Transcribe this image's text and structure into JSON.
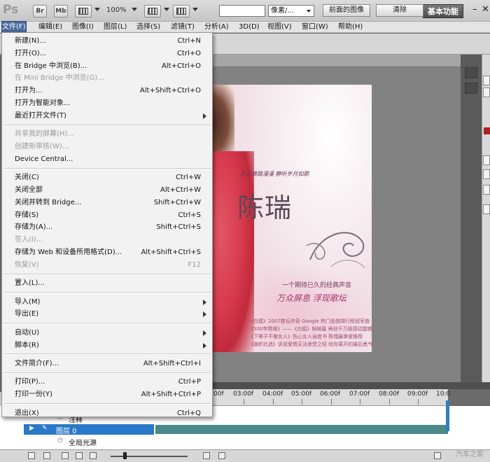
{
  "app": {
    "logo": "Ps",
    "toolbar_buttons": [
      "Br",
      "Mb"
    ],
    "zoom": "100%",
    "workspace": "基本功能",
    "window_controls": [
      "–",
      "✕"
    ]
  },
  "menubar": [
    "文件(F)",
    "编辑(E)",
    "图像(I)",
    "图层(L)",
    "选择(S)",
    "滤镜(T)",
    "分析(A)",
    "3D(D)",
    "视图(V)",
    "窗口(W)",
    "帮助(H)"
  ],
  "options_bar": {
    "unit_select": "像素/...",
    "front_image_button": "前面的图像",
    "clear_button": "清除"
  },
  "file_menu": {
    "groups": [
      [
        {
          "label": "新建(N)...",
          "shortcut": "Ctrl+N"
        },
        {
          "label": "打开(O)...",
          "shortcut": "Ctrl+O"
        },
        {
          "label": "在 Bridge 中浏览(B)...",
          "shortcut": "Alt+Ctrl+O"
        },
        {
          "label": "在 Mini Bridge 中浏览(G)...",
          "shortcut": "",
          "disabled": true
        },
        {
          "label": "打开为...",
          "shortcut": "Alt+Shift+Ctrl+O"
        },
        {
          "label": "打开为智能对象...",
          "shortcut": ""
        },
        {
          "label": "最近打开文件(T)",
          "shortcut": "",
          "submenu": true
        }
      ],
      [
        {
          "label": "共享我的屏幕(H)...",
          "shortcut": "",
          "disabled": true
        },
        {
          "label": "创建新审核(W)...",
          "shortcut": "",
          "disabled": true
        },
        {
          "label": "Device Central...",
          "shortcut": ""
        }
      ],
      [
        {
          "label": "关闭(C)",
          "shortcut": "Ctrl+W"
        },
        {
          "label": "关闭全部",
          "shortcut": "Alt+Ctrl+W"
        },
        {
          "label": "关闭并转到 Bridge...",
          "shortcut": "Shift+Ctrl+W"
        },
        {
          "label": "存储(S)",
          "shortcut": "Ctrl+S"
        },
        {
          "label": "存储为(A)...",
          "shortcut": "Shift+Ctrl+S"
        },
        {
          "label": "签入(I)...",
          "shortcut": "",
          "disabled": true
        },
        {
          "label": "存储为 Web 和设备所用格式(D)...",
          "shortcut": "Alt+Shift+Ctrl+S"
        },
        {
          "label": "恢复(V)",
          "shortcut": "F12",
          "disabled": true
        }
      ],
      [
        {
          "label": "置入(L)...",
          "shortcut": ""
        }
      ],
      [
        {
          "label": "导入(M)",
          "shortcut": "",
          "submenu": true
        },
        {
          "label": "导出(E)",
          "shortcut": "",
          "submenu": true
        }
      ],
      [
        {
          "label": "自动(U)",
          "shortcut": "",
          "submenu": true
        },
        {
          "label": "脚本(R)",
          "shortcut": "",
          "submenu": true
        }
      ],
      [
        {
          "label": "文件简介(F)...",
          "shortcut": "Alt+Shift+Ctrl+I"
        }
      ],
      [
        {
          "label": "打印(P)...",
          "shortcut": "Ctrl+P"
        },
        {
          "label": "打印一份(Y)",
          "shortcut": "Alt+Shift+Ctrl+P"
        }
      ],
      [
        {
          "label": "退出(X)",
          "shortcut": "Ctrl+Q"
        }
      ]
    ]
  },
  "poster": {
    "subtitle": "走过情路漫漫  静听岁月如歌",
    "name": "陈瑞",
    "tagline": "一个期待已久的经典声音",
    "motto": "万众屏息  浮现歌坛",
    "info_lines": [
      "《白狐》2007数坛传奇  Google 热门金曲排行榜冠军曲",
      "《300年情缘》——《白狐》姊妹篇  再创千万级感动震撼",
      "《下辈子不做女人》伤心女人自度书  陈瑞最挚爱推荐",
      "《旗帜社选》诉说爱情无法承受之轻  给你离开的最后勇气"
    ]
  },
  "timeline": {
    "ticks": [
      "00f",
      "03:00f",
      "04:00f",
      "05:00f",
      "06:00f",
      "07:00f",
      "08:00f",
      "09:00f",
      "10:0"
    ],
    "layers": [
      {
        "name": "注释"
      },
      {
        "name": "图层 0",
        "selected": true
      },
      {
        "name": "全局光源"
      }
    ]
  },
  "watermark": "汽车之家"
}
